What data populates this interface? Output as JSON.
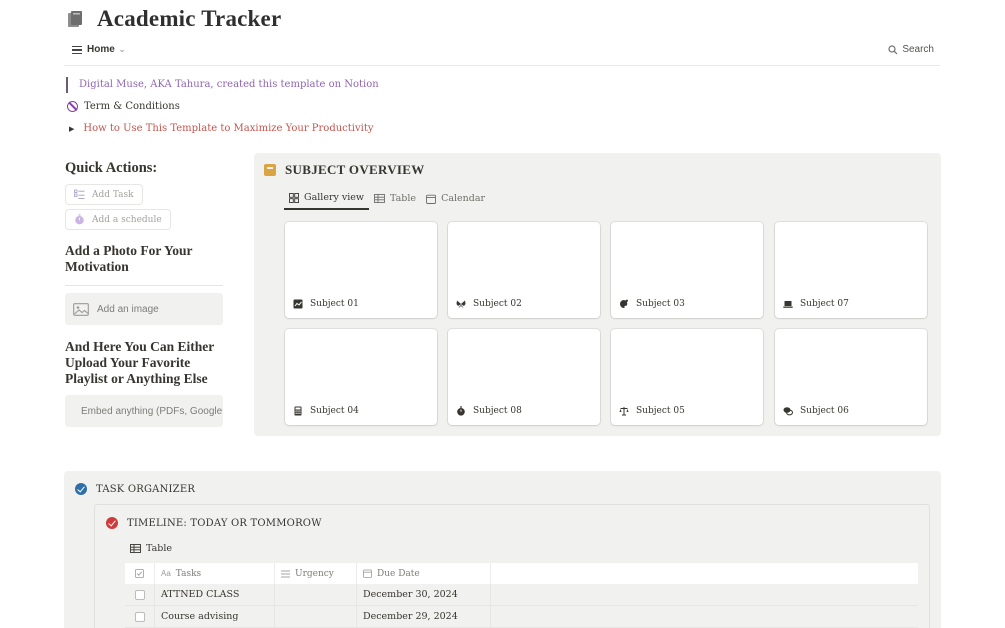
{
  "page": {
    "title": "Academic Tracker",
    "icon": "book-stack-icon"
  },
  "viewbar": {
    "view_label": "Home",
    "search_label": "Search"
  },
  "intro": {
    "quote": "Digital Muse, AKA Tahura, created this template on Notion",
    "terms_link": "Term & Conditions",
    "howto_toggle": "How to Use This Template to Maximize Your Productivity"
  },
  "sidebar": {
    "quick_actions_heading": "Quick Actions:",
    "add_task_label": "Add Task",
    "add_schedule_label": "Add a schedule",
    "photo_heading": "Add a Photo For Your Motivation",
    "add_image_label": "Add an image",
    "embed_heading": "And Here You Can Either Upload Your Favorite Playlist or Anything Else",
    "embed_label": "Embed anything (PDFs, Google Drive, and more)"
  },
  "overview": {
    "title": "SUBJECT OVERVIEW",
    "tabs": [
      {
        "label": "Gallery view",
        "icon": "gallery-icon",
        "active": true
      },
      {
        "label": "Table",
        "icon": "table-icon",
        "active": false
      },
      {
        "label": "Calendar",
        "icon": "calendar-icon",
        "active": false
      }
    ],
    "cards": [
      {
        "label": "Subject 01",
        "icon": "chart-icon"
      },
      {
        "label": "Subject 02",
        "icon": "butterfly-icon"
      },
      {
        "label": "Subject 03",
        "icon": "palette-icon"
      },
      {
        "label": "Subject 07",
        "icon": "laptop-icon"
      },
      {
        "label": "Subject 04",
        "icon": "calculator-icon"
      },
      {
        "label": "Subject 08",
        "icon": "stopwatch-icon"
      },
      {
        "label": "Subject 05",
        "icon": "scales-icon"
      },
      {
        "label": "Subject 06",
        "icon": "chat-icon"
      }
    ]
  },
  "organizer": {
    "title": "TASK ORGANIZER",
    "timeline_title": "TIMELINE: TODAY OR TOMMOROW",
    "table_tab": "Table",
    "columns": [
      "Tasks",
      "Urgency",
      "Due Date"
    ],
    "rows": [
      {
        "task": "ATTNED CLASS",
        "urgency": "",
        "due": "December 30, 2024"
      },
      {
        "task": "Course advising",
        "urgency": "",
        "due": "December 29, 2024"
      }
    ]
  },
  "colors": {
    "quote_text": "#9065b0",
    "howto_text": "#c4554d",
    "panel_bg": "#f1f1ef",
    "check_blue": "#2f6fa8",
    "check_red": "#cf3b3b",
    "book_icon": "#d9a441"
  }
}
